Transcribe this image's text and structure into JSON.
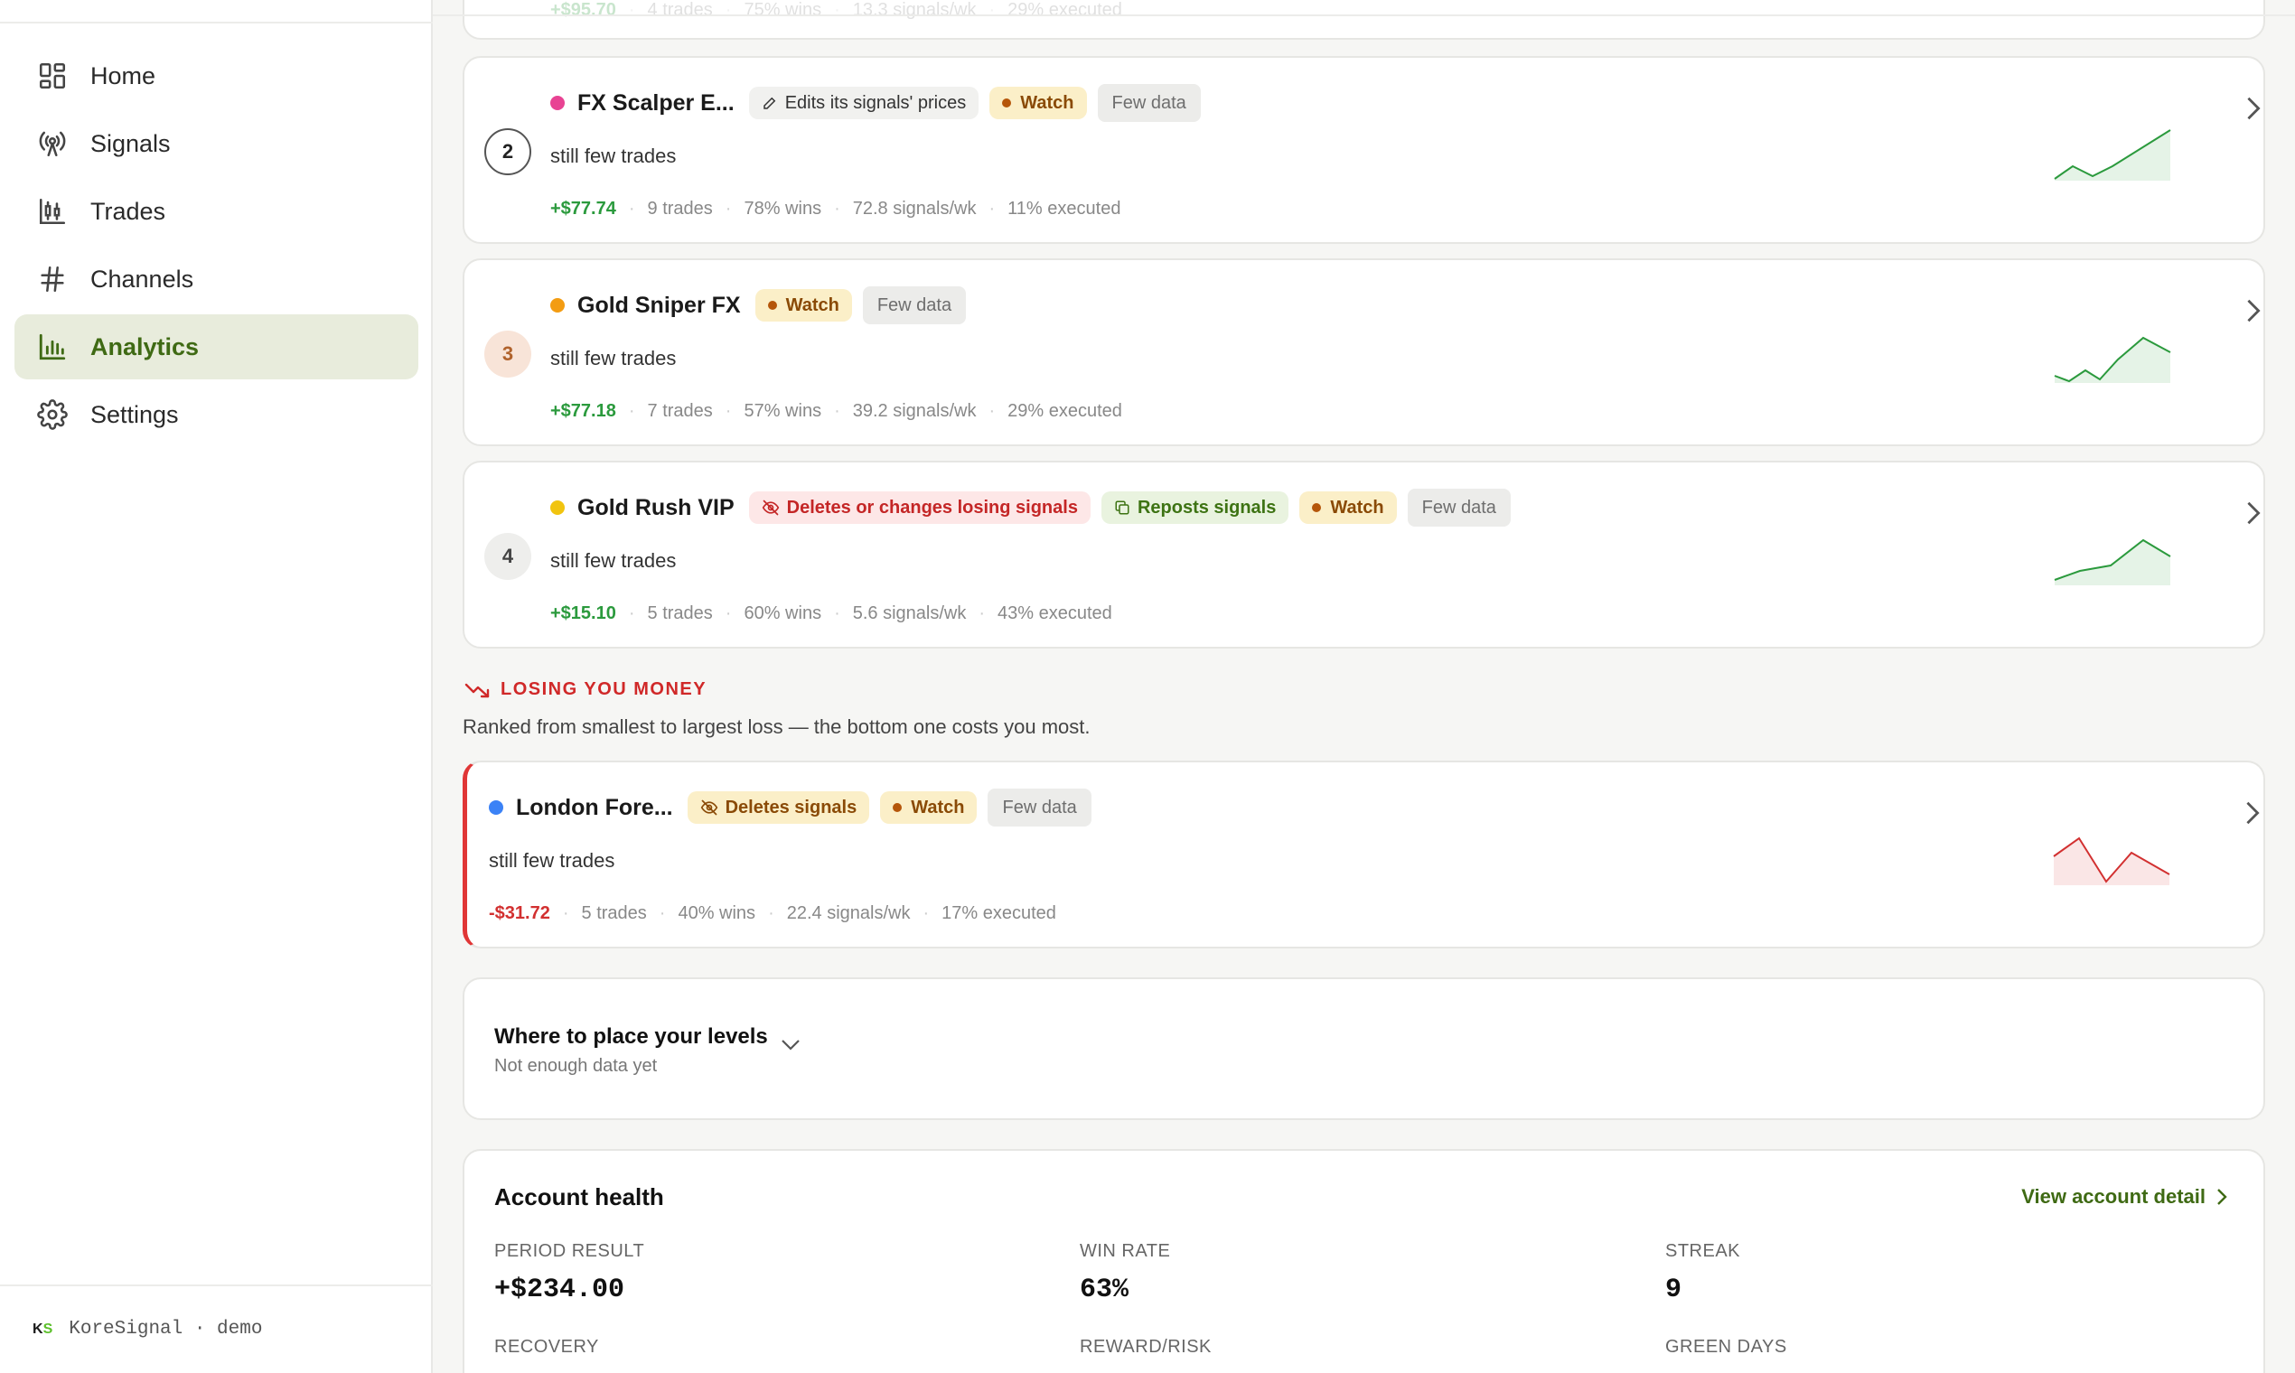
{
  "sidebar": {
    "items": [
      {
        "label": "Home",
        "icon": "grid-icon"
      },
      {
        "label": "Signals",
        "icon": "broadcast-icon"
      },
      {
        "label": "Trades",
        "icon": "candles-icon"
      },
      {
        "label": "Channels",
        "icon": "hash-icon"
      },
      {
        "label": "Analytics",
        "icon": "bar-chart-icon",
        "active": true
      },
      {
        "label": "Settings",
        "icon": "gear-icon"
      }
    ],
    "brand": "KoreSignal · demo",
    "accent": "#3f6a14"
  },
  "top_partial": {
    "pnl": "+$95.70",
    "trades": "4 trades",
    "wins": "75% wins",
    "signals": "13.3 signals/wk",
    "executed": "29% executed"
  },
  "rows": [
    {
      "rank": "2",
      "name": "FX Scalper E...",
      "dot_color": "#e84393",
      "chips": {
        "edit": "Edits its signals' prices",
        "watch": "Watch",
        "few": "Few data"
      },
      "subtext": "still few trades",
      "pnl": "+$77.74",
      "trades": "9 trades",
      "wins": "78% wins",
      "signals": "72.8 signals/wk",
      "executed": "11% executed"
    },
    {
      "rank": "3",
      "name": "Gold Sniper FX",
      "dot_color": "#f39c12",
      "chips": {
        "watch": "Watch",
        "few": "Few data"
      },
      "subtext": "still few trades",
      "pnl": "+$77.18",
      "trades": "7 trades",
      "wins": "57% wins",
      "signals": "39.2 signals/wk",
      "executed": "29% executed"
    },
    {
      "rank": "4",
      "name": "Gold Rush VIP",
      "dot_color": "#f1c40f",
      "chips": {
        "danger": "Deletes or changes losing signals",
        "repost": "Reposts signals",
        "watch": "Watch",
        "few": "Few data"
      },
      "subtext": "still few trades",
      "pnl": "+$15.10",
      "trades": "5 trades",
      "wins": "60% wins",
      "signals": "5.6 signals/wk",
      "executed": "43% executed"
    }
  ],
  "losing": {
    "heading": "LOSING YOU MONEY",
    "description": "Ranked from smallest to largest loss — the bottom one costs you most.",
    "row": {
      "name": "London Fore...",
      "dot_color": "#3b82f6",
      "chips": {
        "delete": "Deletes signals",
        "watch": "Watch",
        "few": "Few data"
      },
      "subtext": "still few trades",
      "pnl": "-$31.72",
      "trades": "5 trades",
      "wins": "40% wins",
      "signals": "22.4 signals/wk",
      "executed": "17% executed"
    }
  },
  "levels": {
    "title": "Where to place your levels",
    "subtitle": "Not enough data yet"
  },
  "account_health": {
    "title": "Account health",
    "link": "View account detail",
    "period_result_label": "PERIOD RESULT",
    "period_result": "+$234.00",
    "win_rate_label": "WIN RATE",
    "win_rate": "63%",
    "streak_label": "STREAK",
    "streak": "9",
    "recovery_label": "RECOVERY",
    "reward_risk_label": "REWARD/RISK",
    "green_days_label": "GREEN DAYS"
  },
  "colors": {
    "positive": "#2b9a3d",
    "negative": "#d23030",
    "watch_bg": "#fbefc8"
  }
}
